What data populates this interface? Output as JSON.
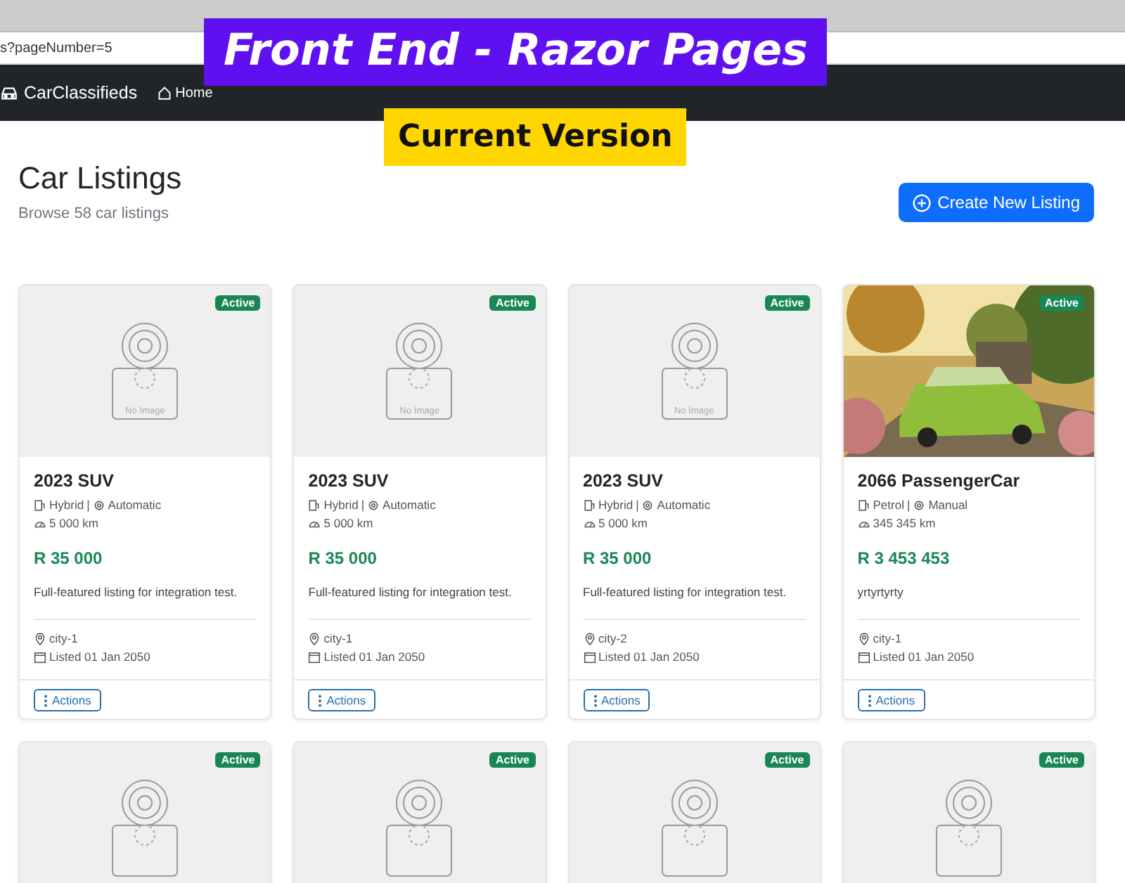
{
  "browser": {
    "address": "s?pageNumber=5"
  },
  "navbar": {
    "brand": "CarClassifieds",
    "links": [
      {
        "label": "Home"
      }
    ]
  },
  "overlay": {
    "title": "Front End - Razor Pages",
    "subtitle": "Current Version"
  },
  "header": {
    "title": "Car Listings",
    "subtitle": "Browse 58 car listings",
    "button": "Create New Listing"
  },
  "listings": [
    {
      "status": "Active",
      "image": {
        "kind": "placeholder",
        "text": "No Image"
      },
      "title": "2023 SUV",
      "fuel": "Hybrid",
      "separator": "|",
      "transmission": "Automatic",
      "mileage": "5 000 km",
      "price": "R 35 000",
      "description": "Full-featured listing for integration test.",
      "location": "city-1",
      "listed": "Listed 01 Jan 2050",
      "action": "Actions"
    },
    {
      "status": "Active",
      "image": {
        "kind": "placeholder",
        "text": "No Image"
      },
      "title": "2023 SUV",
      "fuel": "Hybrid",
      "separator": "|",
      "transmission": "Automatic",
      "mileage": "5 000 km",
      "price": "R 35 000",
      "description": "Full-featured listing for integration test.",
      "location": "city-1",
      "listed": "Listed 01 Jan 2050",
      "action": "Actions"
    },
    {
      "status": "Active",
      "image": {
        "kind": "placeholder",
        "text": "No Image"
      },
      "title": "2023 SUV",
      "fuel": "Hybrid",
      "separator": "|",
      "transmission": "Automatic",
      "mileage": "5 000 km",
      "price": "R 35 000",
      "description": "Full-featured listing for integration test.",
      "location": "city-2",
      "listed": "Listed 01 Jan 2050",
      "action": "Actions"
    },
    {
      "status": "Active",
      "title": "2066 PassengerCar",
      "fuel": "Petrol",
      "separator": "|",
      "transmission": "Manual",
      "mileage": "345 345 km",
      "price": "R 3 453 453",
      "description": "yrtyrtyrty",
      "location": "city-1",
      "listed": "Listed 01 Jan 2050",
      "action": "Actions"
    },
    {
      "status": "Active",
      "image": {
        "kind": "placeholder"
      }
    },
    {
      "status": "Active",
      "image": {
        "kind": "placeholder"
      }
    },
    {
      "status": "Active",
      "image": {
        "kind": "placeholder"
      }
    },
    {
      "status": "Active",
      "image": {
        "kind": "placeholder"
      }
    }
  ]
}
